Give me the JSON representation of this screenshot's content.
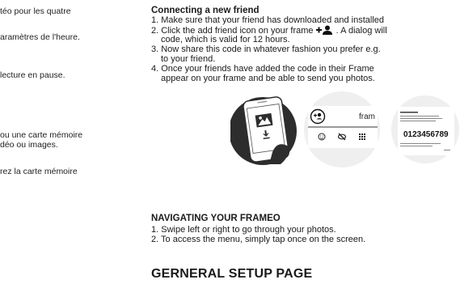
{
  "left_column": [
    "téo pour les quatre",
    "aramètres de l'heure.",
    "lecture en pause.",
    "ou une carte mémoire",
    "déo ou images.",
    "rez la carte mémoire"
  ],
  "connecting": {
    "title": "Connecting a new friend",
    "step1": "1. Make sure that your friend has downloaded and installed",
    "step2a": "2. Click the add friend icon on your frame",
    "step2b": ". A dialog will",
    "step2c": "code, which is valid for 12 hours.",
    "step3a": "3. Now share this code in whatever fashion you prefer e.g.",
    "step3b": "to your friend.",
    "step4a": "4. Once your friends have added the code in their Frame",
    "step4b": "appear on your frame and be able to send you photos."
  },
  "illustration": {
    "frame_label": "fram",
    "code": "0123456789"
  },
  "navigating": {
    "title": "NAVIGATING YOUR FRAMEO",
    "item1": "1. Swipe left or right to go through your photos.",
    "item2": "2. To access the menu, simply tap once on the screen."
  },
  "setup_title": "GERNERAL SETUP PAGE"
}
